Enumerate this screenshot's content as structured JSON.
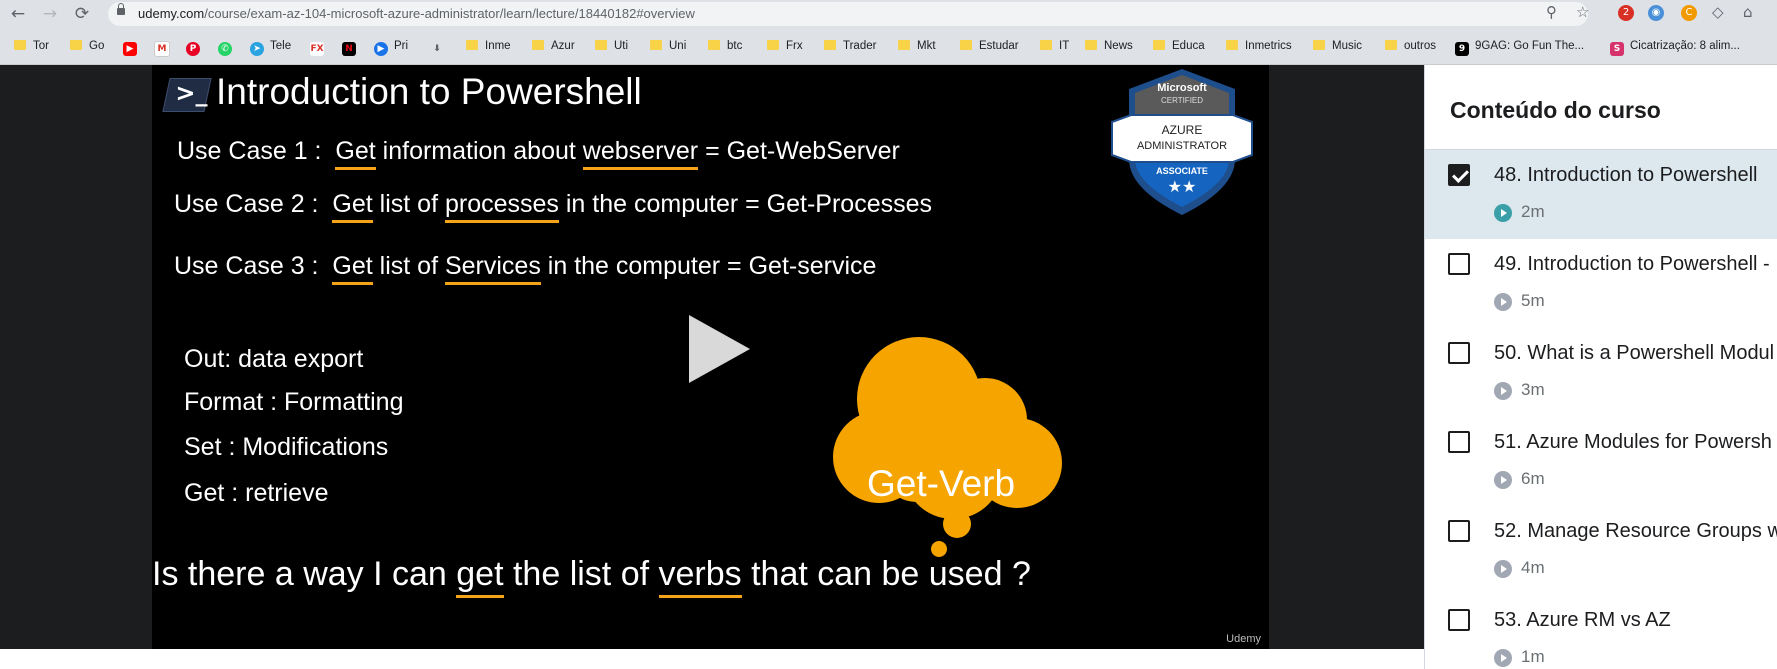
{
  "browser": {
    "url_host": "udemy.com",
    "url_path": "/course/exam-az-104-microsoft-azure-administrator/learn/lecture/18440182#overview",
    "extension_badge": "2"
  },
  "bookmarks": [
    "Tor",
    "Go",
    "",
    "",
    "",
    "",
    "Tele",
    "",
    "",
    "Pri",
    "",
    "Inme",
    "Azur",
    "Uti",
    "Uni",
    "btc",
    "Frx",
    "Trader",
    "Mkt",
    "Estudar",
    "IT",
    "News",
    "Educa",
    "Inmetrics",
    "Music",
    "outros",
    "9GAG: Go Fun The...",
    "Cicatrização: 8 alim..."
  ],
  "slide": {
    "title": "Introduction to Powershell",
    "use_cases": [
      {
        "label": "Use Case 1 :",
        "pre": "",
        "verb": "Get",
        "mid": " information about ",
        "noun": "webserver",
        "post": " = Get-WebServer"
      },
      {
        "label": "Use Case 2 :",
        "pre": "",
        "verb": "Get",
        "mid": " list of ",
        "noun": "processes",
        "post": " in the computer =  Get-Processes"
      },
      {
        "label": "Use Case 3 :",
        "pre": "",
        "verb": "Get",
        "mid": " list of ",
        "noun": "Services",
        "post": " in the computer =  Get-service"
      }
    ],
    "verbs": [
      "Out: data export",
      "Format : Formatting",
      "Set : Modifications",
      "Get : retrieve"
    ],
    "cloud_text": "Get-Verb",
    "question_pre": "Is there a way I can ",
    "question_get": "get",
    "question_mid": " the list of ",
    "question_verbs": "verbs",
    "question_post": " that can be used ?",
    "badge": {
      "top": "Microsoft",
      "top2": "CERTIFIED",
      "line1": "AZURE",
      "line2": "ADMINISTRATOR",
      "level": "ASSOCIATE"
    },
    "watermark": "Udemy"
  },
  "sidebar": {
    "title": "Conteúdo do curso",
    "lessons": [
      {
        "title": "48. Introduction to Powershell",
        "duration": "2m",
        "checked": true
      },
      {
        "title": "49. Introduction to Powershell -",
        "duration": "5m",
        "checked": false
      },
      {
        "title": "50. What is a Powershell Modul",
        "duration": "3m",
        "checked": false
      },
      {
        "title": "51. Azure Modules for Powersh",
        "duration": "6m",
        "checked": false
      },
      {
        "title": "52. Manage Resource Groups w",
        "duration": "4m",
        "checked": false
      },
      {
        "title": "53. Azure RM vs AZ",
        "duration": "1m",
        "checked": false
      }
    ]
  }
}
